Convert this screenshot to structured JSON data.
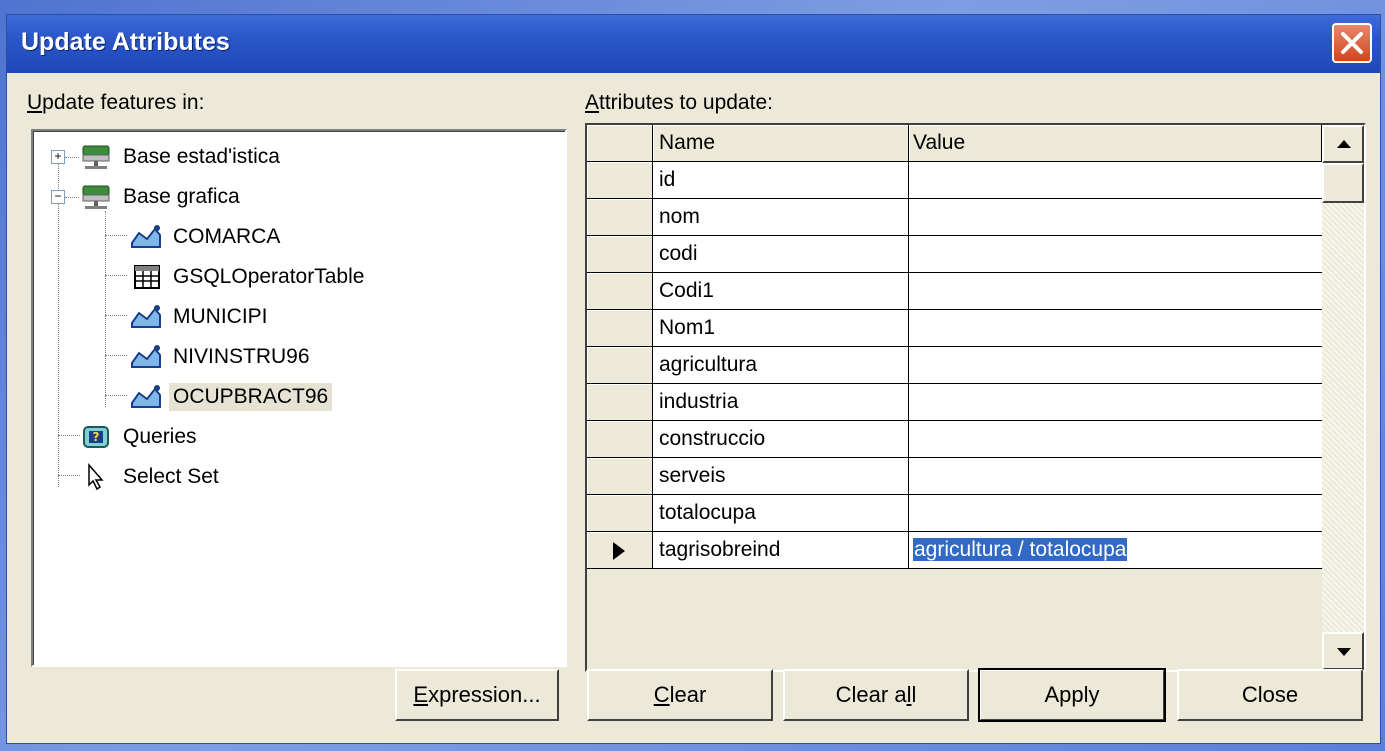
{
  "window": {
    "title": "Update Attributes"
  },
  "left_panel": {
    "label_accel": "U",
    "label_rest": "pdate features in:",
    "tree": [
      {
        "label": "Base estad'istica",
        "icon": "database-icon",
        "expander": "+"
      },
      {
        "label": "Base grafica",
        "icon": "database-icon",
        "expander": "−"
      },
      {
        "label": "COMARCA",
        "icon": "feature-class-icon"
      },
      {
        "label": "GSQLOperatorTable",
        "icon": "table-icon"
      },
      {
        "label": "MUNICIPI",
        "icon": "feature-class-icon"
      },
      {
        "label": "NIVINSTRU96",
        "icon": "feature-class-icon"
      },
      {
        "label": "OCUPBRACT96",
        "icon": "feature-class-icon",
        "selected": true
      },
      {
        "label": "Queries",
        "icon": "query-icon"
      },
      {
        "label": "Select Set",
        "icon": "cursor-icon"
      }
    ]
  },
  "right_panel": {
    "label_accel": "A",
    "label_rest": "ttributes to update:",
    "columns": {
      "name": "Name",
      "value": "Value"
    },
    "rows": [
      {
        "name": "id",
        "value": ""
      },
      {
        "name": "nom",
        "value": ""
      },
      {
        "name": "codi",
        "value": ""
      },
      {
        "name": "Codi1",
        "value": ""
      },
      {
        "name": "Nom1",
        "value": ""
      },
      {
        "name": "agricultura",
        "value": ""
      },
      {
        "name": "industria",
        "value": ""
      },
      {
        "name": "construccio",
        "value": ""
      },
      {
        "name": "serveis",
        "value": ""
      },
      {
        "name": "totalocupa",
        "value": ""
      },
      {
        "name": "tagrisobreind",
        "value": "agricultura  /  totalocupa",
        "current": true
      }
    ]
  },
  "buttons": {
    "expression_accel": "E",
    "expression_rest": "xpression...",
    "clear_accel": "C",
    "clear_rest": "lear",
    "clearall_pre": "Clear a",
    "clearall_accel": "l",
    "clearall_post": "l",
    "apply": "Apply",
    "close": "Close"
  },
  "colors": {
    "titlebar": "#2a56c8",
    "selection": "#316ac5",
    "dialog": "#ece9d8"
  }
}
